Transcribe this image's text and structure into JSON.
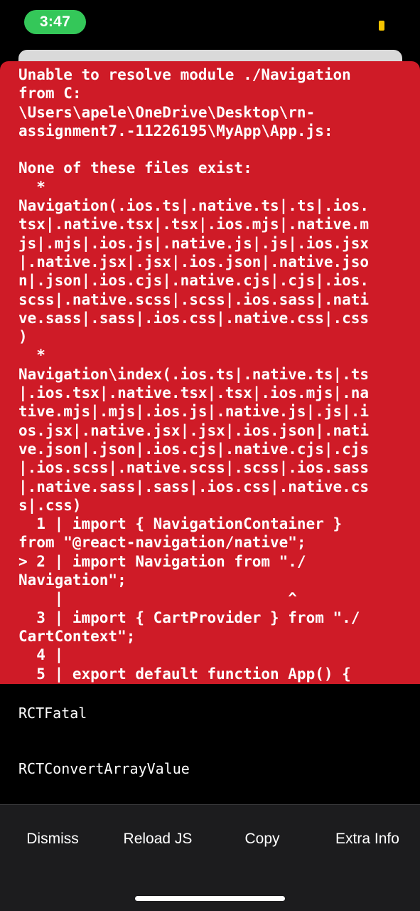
{
  "status_bar": {
    "time": "3:47",
    "battery_color": "#f5c400",
    "time_pill_color": "#34c759"
  },
  "error": {
    "background_color": "#cf1b27",
    "message": "Unable to resolve module ./Navigation\nfrom C:\n\\Users\\apele\\OneDrive\\Desktop\\rn-\nassignment7.-11226195\\MyApp\\App.js:\n\nNone of these files exist:\n  *\nNavigation(.ios.ts|.native.ts|.ts|.ios.\ntsx|.native.tsx|.tsx|.ios.mjs|.native.m\njs|.mjs|.ios.js|.native.js|.js|.ios.jsx\n|.native.jsx|.jsx|.ios.json|.native.jso\nn|.json|.ios.cjs|.native.cjs|.cjs|.ios.\nscss|.native.scss|.scss|.ios.sass|.nati\nve.sass|.sass|.ios.css|.native.css|.css\n)\n  *\nNavigation\\index(.ios.ts|.native.ts|.ts\n|.ios.tsx|.native.tsx|.tsx|.ios.mjs|.na\ntive.mjs|.mjs|.ios.js|.native.js|.js|.i\nos.jsx|.native.jsx|.jsx|.ios.json|.nati\nve.json|.json|.ios.cjs|.native.cjs|.cjs\n|.ios.scss|.native.scss|.scss|.ios.sass\n|.native.sass|.sass|.ios.css|.native.cs\ns|.css)\n  1 | import { NavigationContainer }\nfrom \"@react-navigation/native\";\n> 2 | import Navigation from \"./\nNavigation\";\n    |                         ^\n  3 | import { CartProvider } from \"./\nCartContext\";\n  4 |\n  5 | export default function App() {"
  },
  "stack_trace": {
    "items": [
      "RCTFatal",
      "RCTConvertArrayValue"
    ]
  },
  "toolbar": {
    "dismiss_label": "Dismiss",
    "reload_label": "Reload JS",
    "copy_label": "Copy",
    "extra_info_label": "Extra Info"
  }
}
